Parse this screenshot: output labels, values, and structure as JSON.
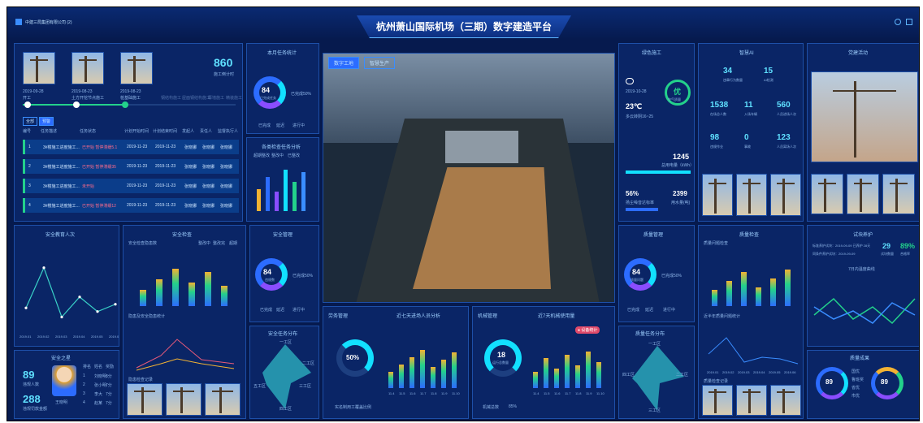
{
  "header": {
    "title": "杭州萧山国际机场（三期）数字建造平台",
    "org": "中建三局集团有限公司 (2)",
    "icons": [
      "info-icon",
      "menu-icon"
    ]
  },
  "progress": {
    "days": "860",
    "days_label": "施工倒计时",
    "milestones": [
      {
        "date": "2019-09-28",
        "label": "开工"
      },
      {
        "date": "2019-08-23",
        "label": "土方开挖节点施工"
      },
      {
        "date": "2019-08-23",
        "label": "桩基础施工"
      }
    ],
    "future_labels": [
      "钢结构施工",
      "屋面钢结构施工",
      "幕墙施工",
      "精装施工"
    ]
  },
  "task_table": {
    "tabs": [
      "全部",
      "预警"
    ],
    "headers": [
      "编号",
      "任务描述",
      "任务状态",
      "计划开始时间",
      "计划结束时间",
      "发起人",
      "责任人",
      "监督执行人"
    ],
    "rows": [
      {
        "no": "1",
        "desc": "3#楼施工进度施工...",
        "status": "已开始 暂停滞缓5.1",
        "start": "2019-11-23",
        "end": "2019-11-23",
        "a": "张晓娜",
        "b": "张晓娜",
        "c": "张晓娜"
      },
      {
        "no": "2",
        "desc": "3#楼施工进度施工...",
        "status": "已开始 暂停滞缓35",
        "start": "2019-11-23",
        "end": "2019-11-23",
        "a": "张晓娜",
        "b": "张晓娜",
        "c": "张晓娜"
      },
      {
        "no": "3",
        "desc": "3#楼施工进度施工...",
        "status": "未开始",
        "start": "2019-11-23",
        "end": "2019-11-23",
        "a": "张晓娜",
        "b": "张晓娜",
        "c": "张晓娜"
      },
      {
        "no": "4",
        "desc": "3#楼施工进度施工...",
        "status": "已开始 暂停滞缓12",
        "start": "2019-11-23",
        "end": "2019-11-23",
        "a": "张晓娜",
        "b": "张晓娜",
        "c": "张晓娜"
      }
    ]
  },
  "monthly_tasks": {
    "title": "本月任务统计",
    "value": "84",
    "value_label": "已完成任务",
    "done": "已完成50%",
    "legend": [
      "已完成",
      "延迟",
      "进行中"
    ]
  },
  "inspection": {
    "title": "各类检查任务分析",
    "legend": [
      "超期整改",
      "整改中",
      "已整改"
    ],
    "values": [
      45,
      70,
      40,
      85,
      60,
      80
    ]
  },
  "safety_edu": {
    "title": "安全教育人次",
    "x": [
      "2019.01",
      "2019.02",
      "2019.03",
      "2019.04",
      "2019.05",
      "2019.06"
    ],
    "y": [
      110,
      330,
      60,
      170,
      90,
      130
    ],
    "ylim": [
      0,
      400
    ]
  },
  "safety_check": {
    "title": "安全检查",
    "sub1": "安全检查隐患数",
    "sub2": "隐患及安全隐患统计",
    "sub3": "隐患检查记录",
    "legend": [
      "整改中",
      "整改完",
      "超期"
    ]
  },
  "safety_star": {
    "title": "安全之星",
    "count1": "89",
    "label1": "违规人数",
    "count2": "288",
    "label2": "违规罚款金额",
    "person": "王晓明",
    "table": {
      "headers": [
        "排名",
        "姓名",
        "奖励"
      ],
      "rows": [
        [
          "1",
          "刘晓明",
          "8分"
        ],
        [
          "2",
          "张小明",
          "7分"
        ],
        [
          "3",
          "李大",
          "7分"
        ],
        [
          "4",
          "赵某",
          "7分"
        ]
      ]
    }
  },
  "safety_mgmt": {
    "title": "安全管理",
    "value": "84",
    "value_label": "违规数",
    "done": "已完成50%",
    "legend": [
      "已完成",
      "延迟",
      "进行中"
    ]
  },
  "safety_dist": {
    "title": "安全任务分布",
    "labels": [
      "一工区",
      "二工区",
      "三工区",
      "四工区",
      "五工区"
    ]
  },
  "viewer": {
    "tabs": [
      "数字工地",
      "智慧生产"
    ]
  },
  "labor": {
    "title": "劳务管理",
    "sub": "近七天进场人员分析",
    "value": "50%",
    "footer": "实名制用工覆盖比例",
    "x": [
      "11.4",
      "11.5",
      "11.6",
      "11.7",
      "11.8",
      "11.9",
      "11.10"
    ]
  },
  "machine": {
    "title": "机械管理",
    "sub": "近7天机械使用量",
    "badge": "● 设备统计",
    "value": "18",
    "value_label": "运行总数量",
    "footer": "机械总数",
    "footer_val": "85%",
    "x": [
      "11.4",
      "11.5",
      "11.6",
      "11.7",
      "11.8",
      "11.9",
      "11.10"
    ]
  },
  "green": {
    "title": "绿色施工",
    "date": "2019-10-28",
    "weather": "多云转阴16~25",
    "temp": "23℃",
    "grade": "优",
    "grade_label": "空气质量",
    "power": "1245",
    "power_label": "总用电量（kWh）",
    "water_pct": "56%",
    "water_label": "扬尘噪音达标率",
    "water": "2399",
    "water_unit": "用水量(吨)"
  },
  "stats": {
    "title": "智慧AI",
    "cells": [
      {
        "v": "34",
        "l": "违章行为数量"
      },
      {
        "v": "15",
        "l": "AI检测"
      },
      {
        "v": "1538",
        "l": "在场总人数"
      },
      {
        "v": "11",
        "l": "入场车辆"
      },
      {
        "v": "560",
        "l": "人员进场人次"
      },
      {
        "v": "98",
        "l": "违规作业"
      },
      {
        "v": "0",
        "l": "事故"
      },
      {
        "v": "123",
        "l": "人员离场人次"
      }
    ]
  },
  "party": {
    "title": "党建活动"
  },
  "quality_mgmt": {
    "title": "质量管理",
    "value": "84",
    "value_label": "质量问题",
    "done": "已完成50%",
    "legend": [
      "已完成",
      "延迟",
      "进行中"
    ]
  },
  "quality_dist": {
    "title": "质量任务分布",
    "labels": [
      "一工区",
      "二工区",
      "三工区",
      "四工区"
    ]
  },
  "quality_check": {
    "title": "质量检查",
    "sub1": "质量问题检查",
    "sub2": "近半年质量问题统计",
    "sub3": "质量检查记录",
    "x": [
      "2019.01",
      "2019.02",
      "2019.03",
      "2019.04",
      "2019.05",
      "2019.06"
    ]
  },
  "trial": {
    "title": "试块养护",
    "line1": "标准养护试块：2019-09-09 已养护 28天",
    "line2": "同条件养护试块：2019-09-09",
    "v1": "29",
    "l1": "试块数量",
    "v2": "89%",
    "l2": "合格率",
    "chart_title": "7日内温度曲线"
  },
  "quality_result": {
    "title": "质量成果",
    "v1": "89",
    "v2": "89",
    "legend": [
      "国优",
      "鲁班奖",
      "省优",
      "市优"
    ]
  }
}
